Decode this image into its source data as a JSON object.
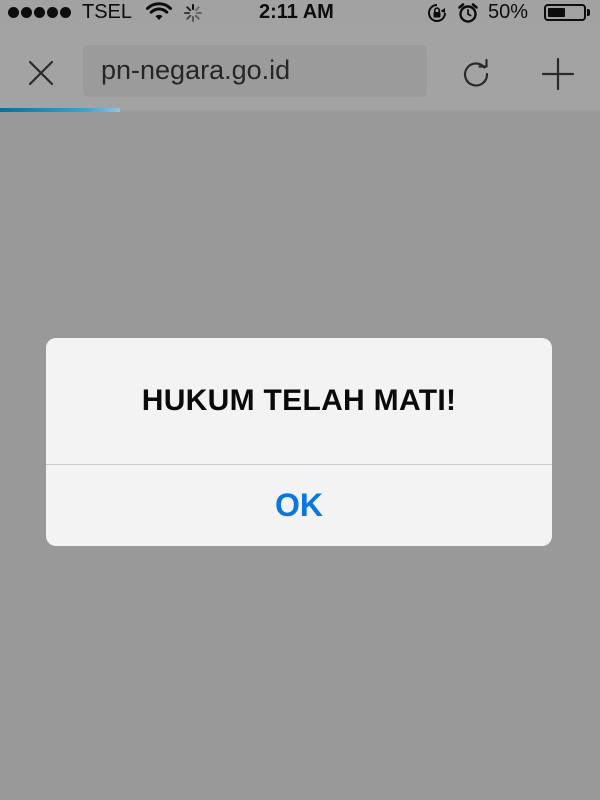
{
  "status_bar": {
    "carrier": "TSEL",
    "time": "2:11 AM",
    "battery_percent": "50%",
    "battery_level": 0.5,
    "signal_bars": 5,
    "icons": [
      "wifi-icon",
      "activity-spinner-icon",
      "rotation-lock-icon",
      "alarm-icon",
      "battery-icon"
    ]
  },
  "browser": {
    "url": "pn-negara.go.id",
    "load_progress": 0.2,
    "icons": [
      "close-icon",
      "reload-icon",
      "add-icon"
    ],
    "accent_color": "#1a7fb0"
  },
  "alert": {
    "title": "HUKUM TELAH MATI!",
    "ok_label": "OK",
    "button_color": "#0a76e0"
  }
}
